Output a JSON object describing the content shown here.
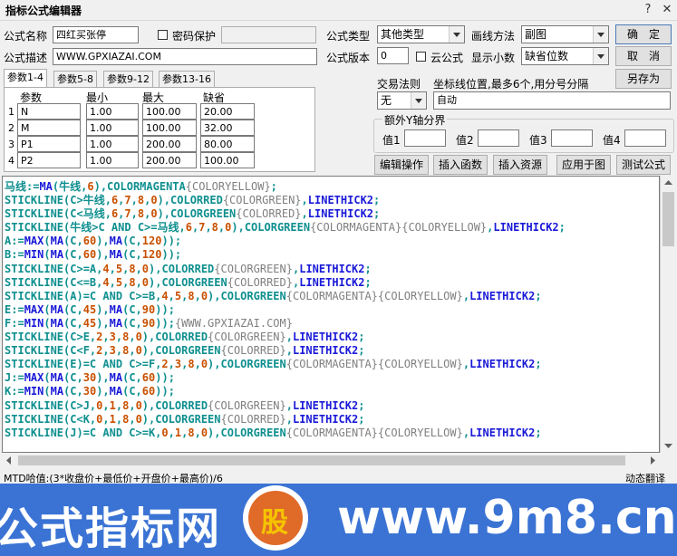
{
  "window": {
    "title": "指标公式编辑器",
    "help_glyph": "?",
    "close_glyph": "✕"
  },
  "formula": {
    "name_label": "公式名称",
    "name_value": "四红买张停",
    "password_label": "密码保护",
    "desc_label": "公式描述",
    "desc_value": "WWW.GPXIAZAI.COM",
    "type_label": "公式类型",
    "type_value": "其他类型",
    "draw_label": "画线方法",
    "draw_value": "副图",
    "version_label": "公式版本",
    "version_value": "0",
    "cloud_label": "云公式",
    "decimals_label": "显示小数",
    "decimals_value": "缺省位数"
  },
  "buttons": {
    "ok": "确　定",
    "cancel": "取　消",
    "save_as": "另存为",
    "edit": "编辑操作",
    "insert_func": "插入函数",
    "insert_res": "插入资源",
    "apply": "应用于图",
    "test": "测试公式"
  },
  "tabs": [
    "参数1-4",
    "参数5-8",
    "参数9-12",
    "参数13-16"
  ],
  "params": {
    "headers": [
      "参数",
      "最小",
      "最大",
      "缺省"
    ],
    "rows": [
      {
        "idx": "1",
        "name": "N",
        "min": "1.00",
        "max": "100.00",
        "def": "20.00"
      },
      {
        "idx": "2",
        "name": "M",
        "min": "1.00",
        "max": "100.00",
        "def": "32.00"
      },
      {
        "idx": "3",
        "name": "P1",
        "min": "1.00",
        "max": "200.00",
        "def": "80.00"
      },
      {
        "idx": "4",
        "name": "P2",
        "min": "1.00",
        "max": "200.00",
        "def": "100.00"
      }
    ]
  },
  "trade": {
    "label": "交易法则",
    "value": "无",
    "coord_label": "坐标线位置,最多6个,用分号分隔",
    "coord_value": "自动"
  },
  "yaxis": {
    "group_label": "额外Y轴分界",
    "v1": "值1",
    "v2": "值2",
    "v3": "值3",
    "v4": "值4"
  },
  "code_lines": [
    [
      {
        "t": "马线:=",
        "c": "g"
      },
      {
        "t": "MA",
        "c": "b"
      },
      {
        "t": "(牛线,",
        "c": "g"
      },
      {
        "t": "6",
        "c": "n"
      },
      {
        "t": "),",
        "c": "g"
      },
      {
        "t": "COLORMAGENTA",
        "c": "g"
      },
      {
        "t": "{COLORYELLOW}",
        "c": "x"
      },
      {
        "t": ";",
        "c": "g"
      }
    ],
    [
      {
        "t": "STICKLINE",
        "c": "g"
      },
      {
        "t": "(C>牛线,",
        "c": "g"
      },
      {
        "t": "6",
        "c": "n"
      },
      {
        "t": ",",
        "c": "g"
      },
      {
        "t": "7",
        "c": "n"
      },
      {
        "t": ",",
        "c": "g"
      },
      {
        "t": "8",
        "c": "n"
      },
      {
        "t": ",",
        "c": "g"
      },
      {
        "t": "0",
        "c": "n"
      },
      {
        "t": "),COLORRED",
        "c": "g"
      },
      {
        "t": "{COLORGREEN}",
        "c": "x"
      },
      {
        "t": ",",
        "c": "g"
      },
      {
        "t": "LINETHICK2",
        "c": "b"
      },
      {
        "t": ";",
        "c": "g"
      }
    ],
    [
      {
        "t": "STICKLINE",
        "c": "g"
      },
      {
        "t": "(C<马线,",
        "c": "g"
      },
      {
        "t": "6",
        "c": "n"
      },
      {
        "t": ",",
        "c": "g"
      },
      {
        "t": "7",
        "c": "n"
      },
      {
        "t": ",",
        "c": "g"
      },
      {
        "t": "8",
        "c": "n"
      },
      {
        "t": ",",
        "c": "g"
      },
      {
        "t": "0",
        "c": "n"
      },
      {
        "t": "),COLORGREEN",
        "c": "g"
      },
      {
        "t": "{COLORRED}",
        "c": "x"
      },
      {
        "t": ",",
        "c": "g"
      },
      {
        "t": "LINETHICK2",
        "c": "b"
      },
      {
        "t": ";",
        "c": "g"
      }
    ],
    [
      {
        "t": "STICKLINE",
        "c": "g"
      },
      {
        "t": "(牛线>C AND C>=马线,",
        "c": "g"
      },
      {
        "t": "6",
        "c": "n"
      },
      {
        "t": ",",
        "c": "g"
      },
      {
        "t": "7",
        "c": "n"
      },
      {
        "t": ",",
        "c": "g"
      },
      {
        "t": "8",
        "c": "n"
      },
      {
        "t": ",",
        "c": "g"
      },
      {
        "t": "0",
        "c": "n"
      },
      {
        "t": "),COLORGREEN",
        "c": "g"
      },
      {
        "t": "{COLORMAGENTA}{COLORYELLOW}",
        "c": "x"
      },
      {
        "t": ",",
        "c": "g"
      },
      {
        "t": "LINETHICK2",
        "c": "b"
      },
      {
        "t": ";",
        "c": "g"
      }
    ],
    [
      {
        "t": "A:=",
        "c": "g"
      },
      {
        "t": "MAX",
        "c": "b"
      },
      {
        "t": "(",
        "c": "g"
      },
      {
        "t": "MA",
        "c": "b"
      },
      {
        "t": "(C,",
        "c": "g"
      },
      {
        "t": "60",
        "c": "n"
      },
      {
        "t": "),",
        "c": "g"
      },
      {
        "t": "MA",
        "c": "b"
      },
      {
        "t": "(C,",
        "c": "g"
      },
      {
        "t": "120",
        "c": "n"
      },
      {
        "t": "));",
        "c": "g"
      }
    ],
    [
      {
        "t": "B:=",
        "c": "g"
      },
      {
        "t": "MIN",
        "c": "b"
      },
      {
        "t": "(",
        "c": "g"
      },
      {
        "t": "MA",
        "c": "b"
      },
      {
        "t": "(C,",
        "c": "g"
      },
      {
        "t": "60",
        "c": "n"
      },
      {
        "t": "),",
        "c": "g"
      },
      {
        "t": "MA",
        "c": "b"
      },
      {
        "t": "(C,",
        "c": "g"
      },
      {
        "t": "120",
        "c": "n"
      },
      {
        "t": "));",
        "c": "g"
      }
    ],
    [
      {
        "t": "STICKLINE",
        "c": "g"
      },
      {
        "t": "(C>=A,",
        "c": "g"
      },
      {
        "t": "4",
        "c": "n"
      },
      {
        "t": ",",
        "c": "g"
      },
      {
        "t": "5",
        "c": "n"
      },
      {
        "t": ",",
        "c": "g"
      },
      {
        "t": "8",
        "c": "n"
      },
      {
        "t": ",",
        "c": "g"
      },
      {
        "t": "0",
        "c": "n"
      },
      {
        "t": "),COLORRED",
        "c": "g"
      },
      {
        "t": "{COLORGREEN}",
        "c": "x"
      },
      {
        "t": ",",
        "c": "g"
      },
      {
        "t": "LINETHICK2",
        "c": "b"
      },
      {
        "t": ";",
        "c": "g"
      }
    ],
    [
      {
        "t": "STICKLINE",
        "c": "g"
      },
      {
        "t": "(C<=B,",
        "c": "g"
      },
      {
        "t": "4",
        "c": "n"
      },
      {
        "t": ",",
        "c": "g"
      },
      {
        "t": "5",
        "c": "n"
      },
      {
        "t": ",",
        "c": "g"
      },
      {
        "t": "8",
        "c": "n"
      },
      {
        "t": ",",
        "c": "g"
      },
      {
        "t": "0",
        "c": "n"
      },
      {
        "t": "),COLORGREEN",
        "c": "g"
      },
      {
        "t": "{COLORRED}",
        "c": "x"
      },
      {
        "t": ",",
        "c": "g"
      },
      {
        "t": "LINETHICK2",
        "c": "b"
      },
      {
        "t": ";",
        "c": "g"
      }
    ],
    [
      {
        "t": "STICKLINE",
        "c": "g"
      },
      {
        "t": "(A)=C AND C>=B,",
        "c": "g"
      },
      {
        "t": "4",
        "c": "n"
      },
      {
        "t": ",",
        "c": "g"
      },
      {
        "t": "5",
        "c": "n"
      },
      {
        "t": ",",
        "c": "g"
      },
      {
        "t": "8",
        "c": "n"
      },
      {
        "t": ",",
        "c": "g"
      },
      {
        "t": "0",
        "c": "n"
      },
      {
        "t": "),COLORGREEN",
        "c": "g"
      },
      {
        "t": "{COLORMAGENTA}{COLORYELLOW}",
        "c": "x"
      },
      {
        "t": ",",
        "c": "g"
      },
      {
        "t": "LINETHICK2",
        "c": "b"
      },
      {
        "t": ";",
        "c": "g"
      }
    ],
    [
      {
        "t": "E:=",
        "c": "g"
      },
      {
        "t": "MAX",
        "c": "b"
      },
      {
        "t": "(",
        "c": "g"
      },
      {
        "t": "MA",
        "c": "b"
      },
      {
        "t": "(C,",
        "c": "g"
      },
      {
        "t": "45",
        "c": "n"
      },
      {
        "t": "),",
        "c": "g"
      },
      {
        "t": "MA",
        "c": "b"
      },
      {
        "t": "(C,",
        "c": "g"
      },
      {
        "t": "90",
        "c": "n"
      },
      {
        "t": "));",
        "c": "g"
      }
    ],
    [
      {
        "t": "F:=",
        "c": "g"
      },
      {
        "t": "MIN",
        "c": "b"
      },
      {
        "t": "(",
        "c": "g"
      },
      {
        "t": "MA",
        "c": "b"
      },
      {
        "t": "(C,",
        "c": "g"
      },
      {
        "t": "45",
        "c": "n"
      },
      {
        "t": "),",
        "c": "g"
      },
      {
        "t": "MA",
        "c": "b"
      },
      {
        "t": "(C,",
        "c": "g"
      },
      {
        "t": "90",
        "c": "n"
      },
      {
        "t": "));",
        "c": "g"
      },
      {
        "t": "{WWW.GPXIAZAI.COM}",
        "c": "x"
      }
    ],
    [
      {
        "t": "STICKLINE",
        "c": "g"
      },
      {
        "t": "(C>E,",
        "c": "g"
      },
      {
        "t": "2",
        "c": "n"
      },
      {
        "t": ",",
        "c": "g"
      },
      {
        "t": "3",
        "c": "n"
      },
      {
        "t": ",",
        "c": "g"
      },
      {
        "t": "8",
        "c": "n"
      },
      {
        "t": ",",
        "c": "g"
      },
      {
        "t": "0",
        "c": "n"
      },
      {
        "t": "),COLORRED",
        "c": "g"
      },
      {
        "t": "{COLORGREEN}",
        "c": "x"
      },
      {
        "t": ",",
        "c": "g"
      },
      {
        "t": "LINETHICK2",
        "c": "b"
      },
      {
        "t": ";",
        "c": "g"
      }
    ],
    [
      {
        "t": "STICKLINE",
        "c": "g"
      },
      {
        "t": "(C<F,",
        "c": "g"
      },
      {
        "t": "2",
        "c": "n"
      },
      {
        "t": ",",
        "c": "g"
      },
      {
        "t": "3",
        "c": "n"
      },
      {
        "t": ",",
        "c": "g"
      },
      {
        "t": "8",
        "c": "n"
      },
      {
        "t": ",",
        "c": "g"
      },
      {
        "t": "0",
        "c": "n"
      },
      {
        "t": "),COLORGREEN",
        "c": "g"
      },
      {
        "t": "{COLORRED}",
        "c": "x"
      },
      {
        "t": ",",
        "c": "g"
      },
      {
        "t": "LINETHICK2",
        "c": "b"
      },
      {
        "t": ";",
        "c": "g"
      }
    ],
    [
      {
        "t": "STICKLINE",
        "c": "g"
      },
      {
        "t": "(E)=C AND C>=F,",
        "c": "g"
      },
      {
        "t": "2",
        "c": "n"
      },
      {
        "t": ",",
        "c": "g"
      },
      {
        "t": "3",
        "c": "n"
      },
      {
        "t": ",",
        "c": "g"
      },
      {
        "t": "8",
        "c": "n"
      },
      {
        "t": ",",
        "c": "g"
      },
      {
        "t": "0",
        "c": "n"
      },
      {
        "t": "),COLORGREEN",
        "c": "g"
      },
      {
        "t": "{COLORMAGENTA}{COLORYELLOW}",
        "c": "x"
      },
      {
        "t": ",",
        "c": "g"
      },
      {
        "t": "LINETHICK2",
        "c": "b"
      },
      {
        "t": ";",
        "c": "g"
      }
    ],
    [
      {
        "t": "J:=",
        "c": "g"
      },
      {
        "t": "MAX",
        "c": "b"
      },
      {
        "t": "(",
        "c": "g"
      },
      {
        "t": "MA",
        "c": "b"
      },
      {
        "t": "(C,",
        "c": "g"
      },
      {
        "t": "30",
        "c": "n"
      },
      {
        "t": "),",
        "c": "g"
      },
      {
        "t": "MA",
        "c": "b"
      },
      {
        "t": "(C,",
        "c": "g"
      },
      {
        "t": "60",
        "c": "n"
      },
      {
        "t": "));",
        "c": "g"
      }
    ],
    [
      {
        "t": "K:=",
        "c": "g"
      },
      {
        "t": "MIN",
        "c": "b"
      },
      {
        "t": "(",
        "c": "g"
      },
      {
        "t": "MA",
        "c": "b"
      },
      {
        "t": "(C,",
        "c": "g"
      },
      {
        "t": "30",
        "c": "n"
      },
      {
        "t": "),",
        "c": "g"
      },
      {
        "t": "MA",
        "c": "b"
      },
      {
        "t": "(C,",
        "c": "g"
      },
      {
        "t": "60",
        "c": "n"
      },
      {
        "t": "));",
        "c": "g"
      }
    ],
    [
      {
        "t": "STICKLINE",
        "c": "g"
      },
      {
        "t": "(C>J,",
        "c": "g"
      },
      {
        "t": "0",
        "c": "n"
      },
      {
        "t": ",",
        "c": "g"
      },
      {
        "t": "1",
        "c": "n"
      },
      {
        "t": ",",
        "c": "g"
      },
      {
        "t": "8",
        "c": "n"
      },
      {
        "t": ",",
        "c": "g"
      },
      {
        "t": "0",
        "c": "n"
      },
      {
        "t": "),COLORRED",
        "c": "g"
      },
      {
        "t": "{COLORGREEN}",
        "c": "x"
      },
      {
        "t": ",",
        "c": "g"
      },
      {
        "t": "LINETHICK2",
        "c": "b"
      },
      {
        "t": ";",
        "c": "g"
      }
    ],
    [
      {
        "t": "STICKLINE",
        "c": "g"
      },
      {
        "t": "(C<K,",
        "c": "g"
      },
      {
        "t": "0",
        "c": "n"
      },
      {
        "t": ",",
        "c": "g"
      },
      {
        "t": "1",
        "c": "n"
      },
      {
        "t": ",",
        "c": "g"
      },
      {
        "t": "8",
        "c": "n"
      },
      {
        "t": ",",
        "c": "g"
      },
      {
        "t": "0",
        "c": "n"
      },
      {
        "t": "),COLORGREEN",
        "c": "g"
      },
      {
        "t": "{COLORRED}",
        "c": "x"
      },
      {
        "t": ",",
        "c": "g"
      },
      {
        "t": "LINETHICK2",
        "c": "b"
      },
      {
        "t": ";",
        "c": "g"
      }
    ],
    [
      {
        "t": "STICKLINE",
        "c": "g"
      },
      {
        "t": "(J)=C AND C>=K,",
        "c": "g"
      },
      {
        "t": "0",
        "c": "n"
      },
      {
        "t": ",",
        "c": "g"
      },
      {
        "t": "1",
        "c": "n"
      },
      {
        "t": ",",
        "c": "g"
      },
      {
        "t": "8",
        "c": "n"
      },
      {
        "t": ",",
        "c": "g"
      },
      {
        "t": "0",
        "c": "n"
      },
      {
        "t": "),COLORGREEN",
        "c": "g"
      },
      {
        "t": "{COLORMAGENTA}{COLORYELLOW}",
        "c": "x"
      },
      {
        "t": ",",
        "c": "g"
      },
      {
        "t": "LINETHICK2",
        "c": "b"
      },
      {
        "t": ";",
        "c": "g"
      }
    ]
  ],
  "status": {
    "text": "MTD哈值:(3*收盘价+最低价+开盘价+最高价)/6",
    "right": "动态翻译"
  },
  "banner": {
    "left_text": "公式指标网",
    "right_text": "www.9m8.cn",
    "logo_char": "股",
    "logo_sub": "www.9m8.cn"
  },
  "colors": {
    "code_green": "#0f8f8f",
    "code_blue": "#1a1ad8",
    "code_num": "#c85000",
    "code_comment": "#808080",
    "banner": "#3a73d4"
  }
}
